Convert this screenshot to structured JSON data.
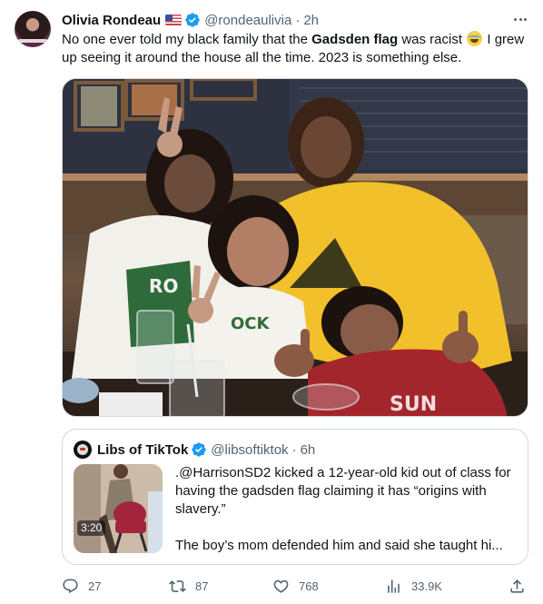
{
  "tweet": {
    "author_name": "Olivia Rondeau",
    "handle": "@rondeaulivia",
    "separator": "·",
    "time": "2h",
    "text_part1": "No one ever told my black family that the ",
    "text_bold": "Gadsden flag",
    "text_part2": " was racist ",
    "text_part3": " I grew up seeing it around the house all the time. 2023 is something else.",
    "emoji": "face-with-tears-of-joy",
    "flag_emoji": "us-flag",
    "shirt_text_left": "RO",
    "shirt_text_right": "OCK",
    "shirt_text_child": "SUN"
  },
  "quote": {
    "author_name": "Libs of TikTok",
    "handle": "@libsoftiktok",
    "separator": "·",
    "time": "6h",
    "video_duration": "3:20",
    "text_line1": ".@HarrisonSD2 kicked a 12-year-old kid out of class for having the gadsden flag claiming it has “origins with slavery.”",
    "text_line2": "The boy’s mom defended him and said she taught hi..."
  },
  "actions": {
    "replies": "27",
    "reposts": "87",
    "likes": "768",
    "views": "33.9K"
  },
  "colors": {
    "text": "#0f1419",
    "secondary": "#536471",
    "verified": "#1d9bf0",
    "border": "#cfd9de"
  }
}
